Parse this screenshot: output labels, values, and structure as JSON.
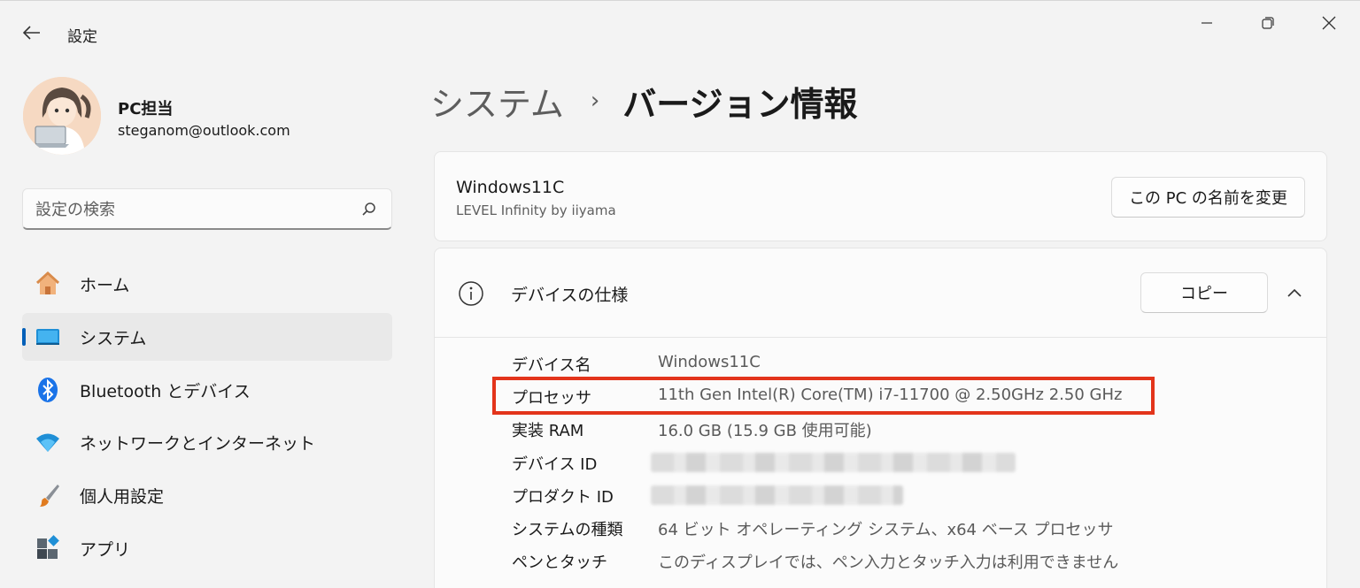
{
  "app": {
    "title": "設定"
  },
  "user": {
    "name": "PC担当",
    "email": "steganom@outlook.com"
  },
  "search": {
    "placeholder": "設定の検索"
  },
  "sidebar": {
    "items": [
      {
        "label": "ホーム",
        "icon": "home-icon",
        "active": false
      },
      {
        "label": "システム",
        "icon": "system-display-icon",
        "active": true
      },
      {
        "label": "Bluetooth とデバイス",
        "icon": "bluetooth-icon",
        "active": false
      },
      {
        "label": "ネットワークとインターネット",
        "icon": "wifi-icon",
        "active": false
      },
      {
        "label": "個人用設定",
        "icon": "paintbrush-icon",
        "active": false
      },
      {
        "label": "アプリ",
        "icon": "apps-icon",
        "active": false
      }
    ]
  },
  "breadcrumb": {
    "parent": "システム",
    "separator": "›",
    "current": "バージョン情報"
  },
  "pc": {
    "name": "Windows11C",
    "model": "LEVEL Infinity by iiyama",
    "rename_label": "この PC の名前を変更"
  },
  "specs": {
    "title": "デバイスの仕様",
    "copy_label": "コピー",
    "rows": [
      {
        "label": "デバイス名",
        "value": "Windows11C"
      },
      {
        "label": "プロセッサ",
        "value": "11th Gen Intel(R) Core(TM) i7-11700 @ 2.50GHz   2.50 GHz"
      },
      {
        "label": "実装 RAM",
        "value": "16.0 GB (15.9 GB 使用可能)"
      },
      {
        "label": "デバイス ID",
        "value": ""
      },
      {
        "label": "プロダクト ID",
        "value": ""
      },
      {
        "label": "システムの種類",
        "value": "64 ビット オペレーティング システム、x64 ベース プロセッサ"
      },
      {
        "label": "ペンとタッチ",
        "value": "このディスプレイでは、ペン入力とタッチ入力は利用できません"
      }
    ]
  },
  "colors": {
    "accent": "#005fb8",
    "highlight": "#e3341b",
    "background": "#f3f3f3"
  }
}
